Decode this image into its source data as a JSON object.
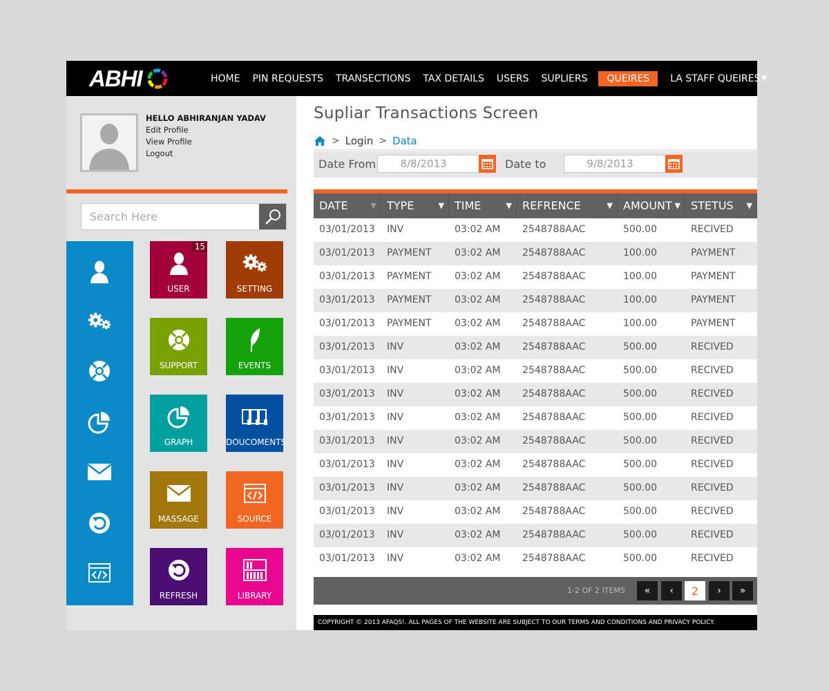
{
  "header": {
    "logo_text": "ABHI",
    "nav": [
      {
        "label": "HOME",
        "active": false
      },
      {
        "label": "PIN REQUESTS",
        "active": false
      },
      {
        "label": "TRANSECTIONS",
        "active": false
      },
      {
        "label": "TAX DETAILS",
        "active": false
      },
      {
        "label": "USERS",
        "active": false
      },
      {
        "label": "SUPLIERS",
        "active": false
      },
      {
        "label": "QUEIRES",
        "active": true
      },
      {
        "label": "LA STAFF QUEIRES",
        "active": false
      }
    ],
    "dropdown_caret": "▼"
  },
  "profile": {
    "greeting": "HELLO ABHIRANJAN YADAV",
    "links": [
      "Edit Profile",
      "View Profile",
      "Logout"
    ]
  },
  "search": {
    "placeholder": "Search Here"
  },
  "sidebar_icons": [
    "user-icon",
    "settings-icon",
    "support-icon",
    "graph-icon",
    "mail-icon",
    "refresh-icon",
    "source-icon"
  ],
  "tiles": [
    {
      "label": "USER",
      "icon": "user-icon",
      "color": "#a3003a",
      "badge": "15"
    },
    {
      "label": "SETTING",
      "icon": "settings-icon",
      "color": "#a23c07"
    },
    {
      "label": "SUPPORT",
      "icon": "support-icon",
      "color": "#7aa104"
    },
    {
      "label": "EVENTS",
      "icon": "feather-icon",
      "color": "#15a10a"
    },
    {
      "label": "GRAPH",
      "icon": "graph-icon",
      "color": "#039f9f"
    },
    {
      "label": "DOUCOMENTS",
      "icon": "documents-icon",
      "color": "#0451a1"
    },
    {
      "label": "MASSAGE",
      "icon": "mail-icon",
      "color": "#a3780a"
    },
    {
      "label": "SOURCE",
      "icon": "source-icon",
      "color": "#f26522"
    },
    {
      "label": "REFRESH",
      "icon": "refresh-icon",
      "color": "#4a0d72"
    },
    {
      "label": "LIBRARY",
      "icon": "library-icon",
      "color": "#e8078d"
    }
  ],
  "main": {
    "title": "Supliar Transactions Screen",
    "breadcrumb": {
      "sep": ">",
      "login": "Login",
      "data": "Data"
    },
    "date_from_label": "Date From",
    "date_from_value": "8/8/2013",
    "date_to_label": "Date to",
    "date_to_value": "9/8/2013"
  },
  "table": {
    "columns": [
      "DATE",
      "TYPE",
      "TIME",
      "REFRENCE",
      "AMOUNT",
      "STETUS"
    ],
    "sort_arrow": "▼",
    "rows": [
      [
        "03/01/2013",
        "INV",
        "03:02 AM",
        "2548788AAC",
        "500.00",
        "RECIVED"
      ],
      [
        "03/01/2013",
        "PAYMENT",
        "03:02 AM",
        "2548788AAC",
        "100.00",
        "PAYMENT"
      ],
      [
        "03/01/2013",
        "PAYMENT",
        "03:02 AM",
        "2548788AAC",
        "100.00",
        "PAYMENT"
      ],
      [
        "03/01/2013",
        "PAYMENT",
        "03:02 AM",
        "2548788AAC",
        "100.00",
        "PAYMENT"
      ],
      [
        "03/01/2013",
        "PAYMENT",
        "03:02 AM",
        "2548788AAC",
        "100.00",
        "PAYMENT"
      ],
      [
        "03/01/2013",
        "INV",
        "03:02 AM",
        "2548788AAC",
        "500.00",
        "RECIVED"
      ],
      [
        "03/01/2013",
        "INV",
        "03:02 AM",
        "2548788AAC",
        "500.00",
        "RECIVED"
      ],
      [
        "03/01/2013",
        "INV",
        "03:02 AM",
        "2548788AAC",
        "500.00",
        "RECIVED"
      ],
      [
        "03/01/2013",
        "INV",
        "03:02 AM",
        "2548788AAC",
        "500.00",
        "RECIVED"
      ],
      [
        "03/01/2013",
        "INV",
        "03:02 AM",
        "2548788AAC",
        "500.00",
        "RECIVED"
      ],
      [
        "03/01/2013",
        "INV",
        "03:02 AM",
        "2548788AAC",
        "500.00",
        "RECIVED"
      ],
      [
        "03/01/2013",
        "INV",
        "03:02 AM",
        "2548788AAC",
        "500.00",
        "RECIVED"
      ],
      [
        "03/01/2013",
        "INV",
        "03:02 AM",
        "2548788AAC",
        "500.00",
        "RECIVED"
      ],
      [
        "03/01/2013",
        "INV",
        "03:02 AM",
        "2548788AAC",
        "500.00",
        "RECIVED"
      ],
      [
        "03/01/2013",
        "INV",
        "03:02 AM",
        "2548788AAC",
        "500.00",
        "RECIVED"
      ]
    ]
  },
  "pager": {
    "info": "1-2 OF 2 ITEMS",
    "current_page": "2",
    "first": "«",
    "prev": "‹",
    "next": "›",
    "last": "»"
  },
  "footer": {
    "text": "COPYRIGHT © 2013 AFAQS!. ALL PAGES OF THE WEBSITE ARE SUBJECT TO OUR TERMS AND CONDITIONS AND PRIVACY POLICY."
  },
  "colors": {
    "accent": "#f26522",
    "sidebar": "#0a8ac6",
    "link": "#0a86c2"
  }
}
